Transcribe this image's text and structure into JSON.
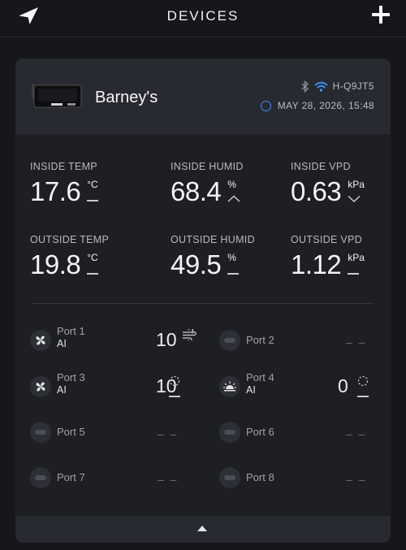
{
  "header": {
    "title": "DEVICES",
    "logo_icon": "bird-logo-icon",
    "add_icon": "plus-icon"
  },
  "device": {
    "name": "Barney's",
    "device_id": "H-Q9JT5",
    "timestamp": "MAY 28, 2026, 15:48",
    "bluetooth_icon": "bluetooth-icon",
    "wifi_icon": "wifi-icon",
    "clock_icon": "clock-icon"
  },
  "colors": {
    "accent": "#3f8ff0",
    "card": "#1d1f23",
    "card_header": "#272a30",
    "background": "#16171a"
  },
  "metrics": {
    "inside_temp": {
      "label": "INSIDE TEMP",
      "value": "17.6",
      "unit": "°C",
      "trend": "flat"
    },
    "inside_humid": {
      "label": "INSIDE HUMID",
      "value": "68.4",
      "unit": "%",
      "trend": "up"
    },
    "inside_vpd": {
      "label": "INSIDE VPD",
      "value": "0.63",
      "unit": "kPa",
      "trend": "down"
    },
    "outside_temp": {
      "label": "OUTSIDE TEMP",
      "value": "19.8",
      "unit": "°C",
      "trend": "flat"
    },
    "outside_humid": {
      "label": "OUTSIDE HUMID",
      "value": "49.5",
      "unit": "%",
      "trend": "flat"
    },
    "outside_vpd": {
      "label": "OUTSIDE VPD",
      "value": "1.12",
      "unit": "kPa",
      "trend": "flat"
    }
  },
  "ports": [
    {
      "name": "Port 1",
      "mode": "AI",
      "level": "10",
      "icon": "fan-icon",
      "status_icon": "wind-icon"
    },
    {
      "name": "Port 2",
      "mode": "",
      "level": "– –",
      "icon": "unplugged-icon"
    },
    {
      "name": "Port 3",
      "mode": "AI",
      "level": "10",
      "icon": "fan-icon",
      "status_icon": "spinner-icon"
    },
    {
      "name": "Port 4",
      "mode": "AI",
      "level": "0",
      "icon": "grow-light-icon",
      "status_icon": "spinner-icon"
    },
    {
      "name": "Port 5",
      "mode": "",
      "level": "– –",
      "icon": "unplugged-icon"
    },
    {
      "name": "Port 6",
      "mode": "",
      "level": "– –",
      "icon": "unplugged-icon"
    },
    {
      "name": "Port 7",
      "mode": "",
      "level": "– –",
      "icon": "unplugged-icon"
    },
    {
      "name": "Port 8",
      "mode": "",
      "level": "– –",
      "icon": "unplugged-icon"
    }
  ],
  "footer": {
    "collapse_icon": "caret-up-icon"
  }
}
